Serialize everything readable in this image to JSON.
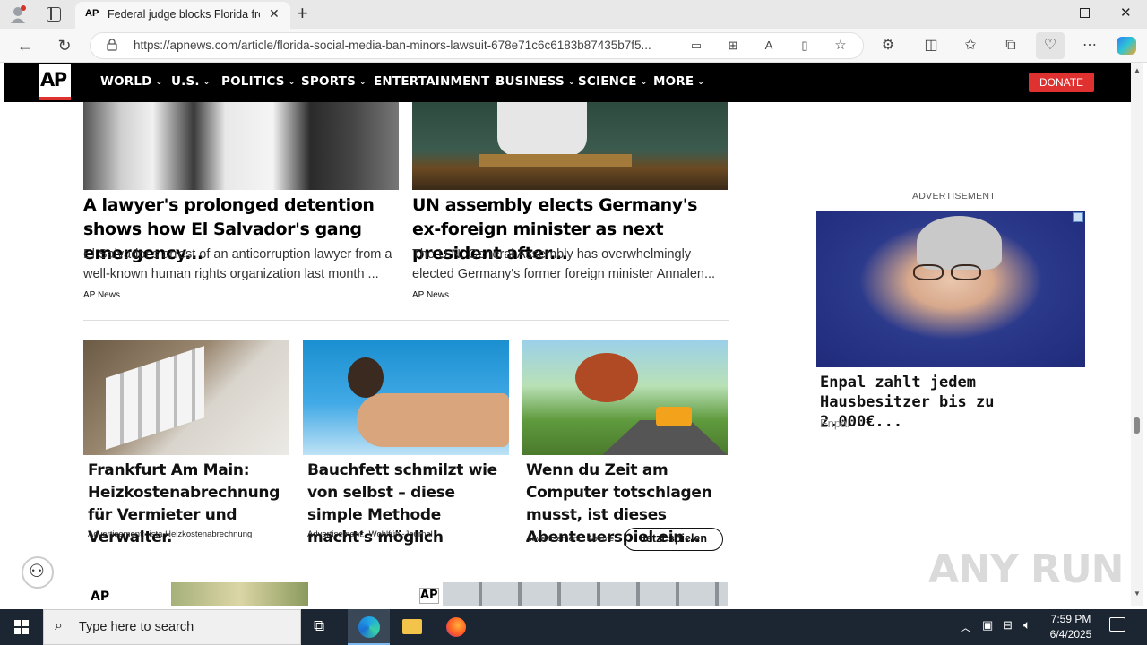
{
  "browser": {
    "tab_title": "Federal judge blocks Florida from",
    "tab_favicon": "AP",
    "url": "https://apnews.com/article/florida-social-media-ban-minors-lawsuit-678e71c6c6183b87435b7f5..."
  },
  "nav": {
    "logo": "AP",
    "items": [
      "WORLD",
      "U.S.",
      "POLITICS",
      "SPORTS",
      "ENTERTAINMENT",
      "BUSINESS",
      "SCIENCE",
      "MORE"
    ],
    "donate": "DONATE"
  },
  "articles": [
    {
      "headline": "A lawyer's prolonged detention shows how El Salvador's gang emergency...",
      "summary": "El Salvador's arrest of an anticorruption lawyer from a well-known human rights organization last month ...",
      "source": "AP News"
    },
    {
      "headline": "UN assembly elects Germany's ex-foreign minister as next president after...",
      "summary": "The U.N. General Assembly has overwhelmingly elected Germany's former foreign minister Annalen...",
      "source": "AP News"
    }
  ],
  "ads": [
    {
      "headline": "Frankfurt Am Main: Heizkostenabrechnung für Vermieter und Verwalter.",
      "label": "Advertisement:",
      "sponsor": "ista Heizkostenabrechnung"
    },
    {
      "headline": "Bauchfett schmilzt wie von selbst – diese simple Methode macht's möglich",
      "label": "Advertisement:",
      "sponsor": "Wohlfühl-Journal"
    },
    {
      "headline": "Wenn du Zeit am Computer totschlagen musst, ist dieses Abenteuerspiel ein...",
      "label": "Advertisement:",
      "sponsor": "Abente...",
      "cta": "Jetzt spielen"
    }
  ],
  "sidebar_ad": {
    "label": "ADVERTISEMENT",
    "headline": "Enpal zahlt jedem Hausbesitzer bis zu 2.000€...",
    "sponsor": "Enpal"
  },
  "watermark": "ANY RUN",
  "taskbar": {
    "search_placeholder": "Type here to search",
    "time": "7:59 PM",
    "date": "6/4/2025"
  }
}
